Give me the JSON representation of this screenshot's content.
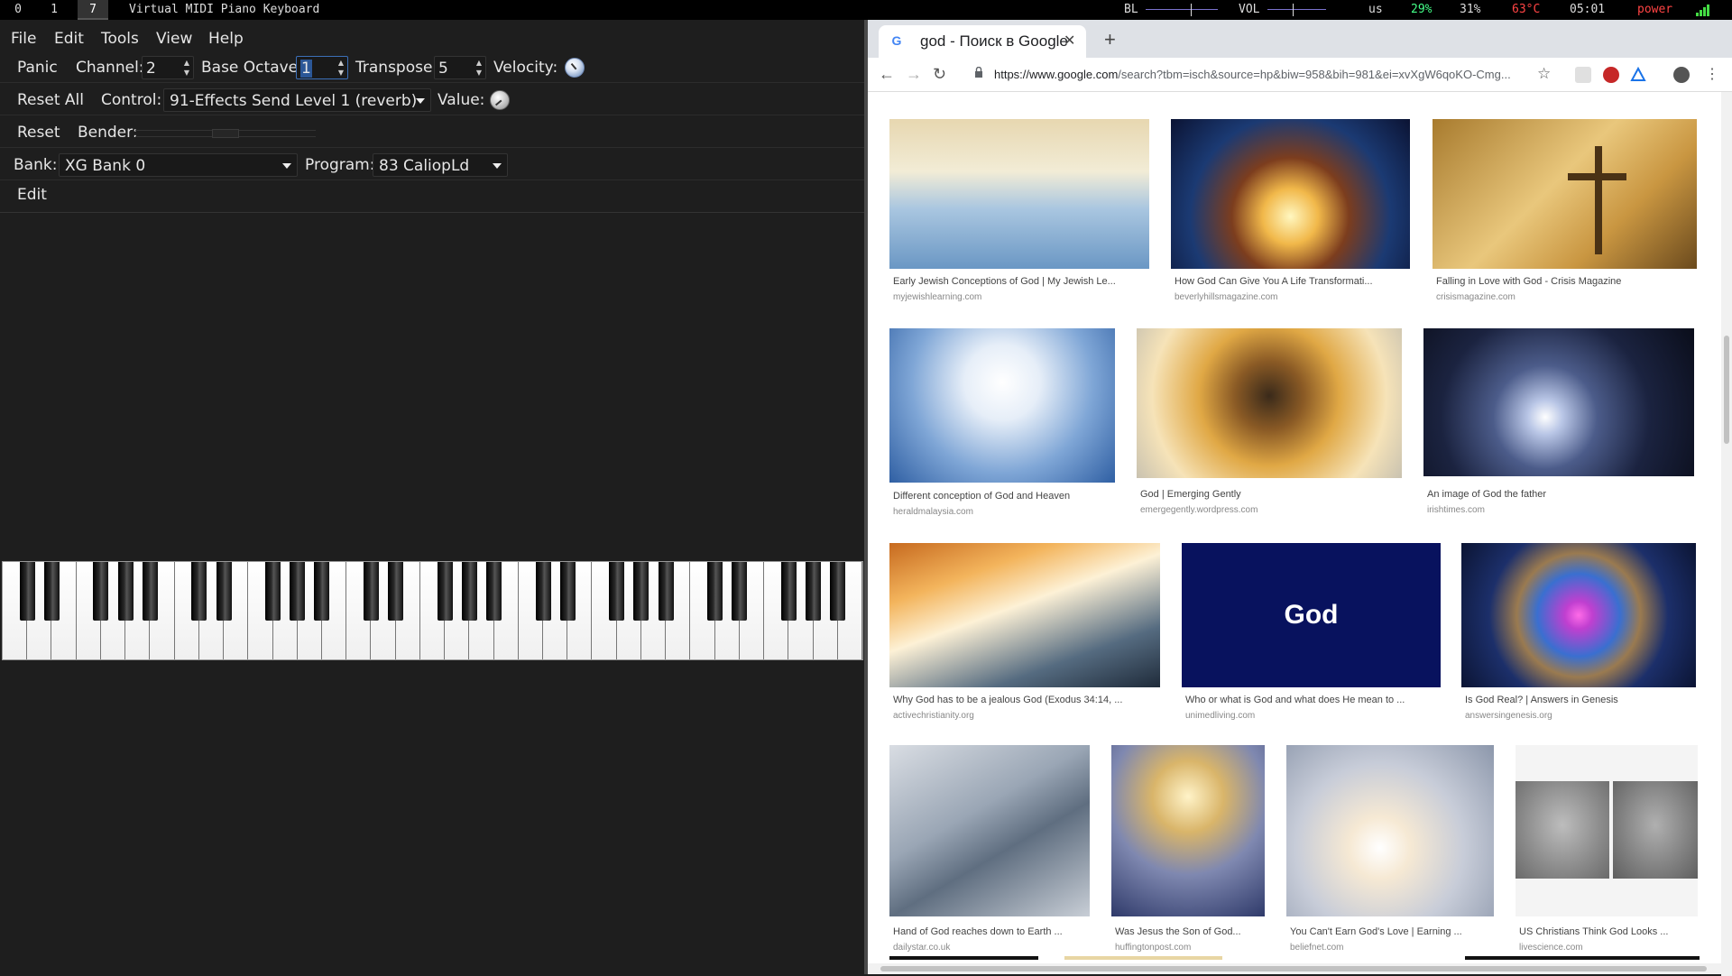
{
  "topbar": {
    "workspaces": [
      "0",
      "1",
      "7"
    ],
    "active_workspace": "7",
    "window_title": "Virtual MIDI Piano Keyboard",
    "backlight_label": "BL",
    "volume_label": "VOL",
    "keyboard_layout": "us",
    "stat1": "29%",
    "stat2": "31%",
    "temperature": "63°C",
    "clock": "05:01",
    "power_label": "power",
    "colors": {
      "temperature": "#ff4444",
      "power": "#ff4444",
      "stat1": "#44ff88"
    }
  },
  "vmpk": {
    "menu": [
      "File",
      "Edit",
      "Tools",
      "View",
      "Help"
    ],
    "row1": {
      "panic": "Panic",
      "channel_label": "Channel:",
      "channel_value": "2",
      "octave_label": "Base Octave:",
      "octave_value": "1",
      "transpose_label": "Transpose:",
      "transpose_value": "5",
      "velocity_label": "Velocity:"
    },
    "row2": {
      "reset_all": "Reset All",
      "control_label": "Control:",
      "control_value": "91-Effects Send Level 1 (reverb)",
      "value_label": "Value:"
    },
    "row3": {
      "reset": "Reset",
      "bender_label": "Bender:"
    },
    "row4": {
      "bank_label": "Bank:",
      "bank_value": "XG Bank 0",
      "program_label": "Program:",
      "program_value": "83 CaliopLd"
    },
    "row5": {
      "edit": "Edit"
    }
  },
  "chrome": {
    "tab_title": "god - Поиск в Google",
    "url_host": "https://www.google.com",
    "url_rest": "/search?tbm=isch&source=hp&biw=958&bih=981&ei=xvXgW6qoKO-Cmg...",
    "results": [
      {
        "title": "Early Jewish Conceptions of God | My Jewish Le...",
        "source": "myjewishlearning.com"
      },
      {
        "title": "How God Can Give You A Life Transformati...",
        "source": "beverlyhillsmagazine.com"
      },
      {
        "title": "Falling in Love with God - Crisis Magazine",
        "source": "crisismagazine.com"
      },
      {
        "title": "Different conception of God and Heaven",
        "source": "heraldmalaysia.com"
      },
      {
        "title": "God | Emerging Gently",
        "source": "emergegently.wordpress.com"
      },
      {
        "title": "An image of God the father",
        "source": "irishtimes.com"
      },
      {
        "title": "Why God has to be a jealous God (Exodus 34:14, ...",
        "source": "activechristianity.org"
      },
      {
        "title": "Who or what is God and what does He mean to ...",
        "source": "unimedliving.com"
      },
      {
        "title": "Is God Real? | Answers in Genesis",
        "source": "answersingenesis.org"
      },
      {
        "title": "Hand of God reaches down to Earth ...",
        "source": "dailystar.co.uk"
      },
      {
        "title": "Was Jesus the Son of God...",
        "source": "huffingtonpost.com"
      },
      {
        "title": "You Can't Earn God's Love | Earning ...",
        "source": "beliefnet.com"
      },
      {
        "title": "US Christians Think God Looks ...",
        "source": "livescience.com"
      }
    ],
    "god_tile_text": "God"
  }
}
